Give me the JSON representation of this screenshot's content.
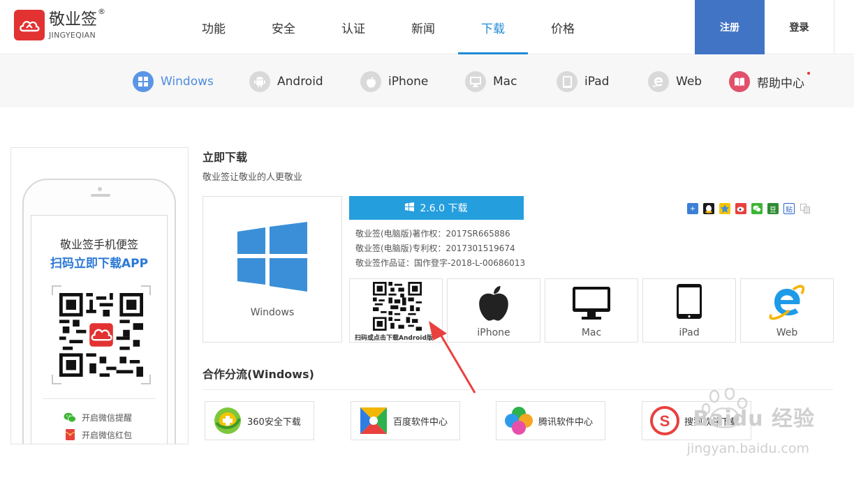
{
  "brand": {
    "name_cn": "敬业签",
    "reg": "®",
    "name_en": "JINGYEQIAN",
    "color": "#e23232"
  },
  "nav": {
    "items": [
      {
        "label": "功能"
      },
      {
        "label": "安全"
      },
      {
        "label": "认证"
      },
      {
        "label": "新闻"
      },
      {
        "label": "下载",
        "active": true
      },
      {
        "label": "价格"
      }
    ],
    "register_label": "注册",
    "login_label": "登录",
    "accent": "#1f8ad6"
  },
  "platforms": [
    {
      "label": "Windows",
      "icon": "windows-icon",
      "active": true
    },
    {
      "label": "Android",
      "icon": "android-icon"
    },
    {
      "label": "iPhone",
      "icon": "apple-icon"
    },
    {
      "label": "Mac",
      "icon": "monitor-icon"
    },
    {
      "label": "iPad",
      "icon": "tablet-icon"
    },
    {
      "label": "Web",
      "icon": "ie-icon"
    },
    {
      "label": "帮助中心",
      "icon": "book-icon",
      "badge": true
    }
  ],
  "phone": {
    "title": "敬业签手机便签",
    "subtitle": "扫码立即下载APP",
    "links": [
      {
        "label": "开启微信提醒",
        "icon": "wechat-icon"
      },
      {
        "label": "开启微信红包",
        "icon": "red-packet-icon"
      }
    ]
  },
  "download": {
    "title": "立即下载",
    "desc": "敬业签让敬业的人更敬业",
    "main_platform": "Windows",
    "button_label": "2.6.0 下载",
    "info": [
      "敬业签(电脑版)著作权：2017SR665886",
      "敬业签(电脑版)专利权：2017301519674",
      "敬业签作品证：国作登字-2018-L-00686013"
    ],
    "qr_label": "扫码或点击下载Android版",
    "cards": [
      {
        "label": "iPhone",
        "icon": "apple-icon"
      },
      {
        "label": "Mac",
        "icon": "monitor-icon"
      },
      {
        "label": "iPad",
        "icon": "tablet-icon"
      },
      {
        "label": "Web",
        "icon": "ie-icon"
      }
    ],
    "share_icons": [
      "share-plus-icon",
      "qq-icon",
      "qzone-icon",
      "weibo-icon",
      "wechat-icon",
      "douban-icon",
      "tieba-icon",
      "copy-icon"
    ]
  },
  "partners": {
    "title": "合作分流(Windows)",
    "items": [
      {
        "label": "360安全下载",
        "icon": "360-icon"
      },
      {
        "label": "百度软件中心",
        "icon": "baidu-soft-icon"
      },
      {
        "label": "腾讯软件中心",
        "icon": "tencent-soft-icon"
      },
      {
        "label": "搜狗软件下载",
        "icon": "sogou-icon"
      }
    ]
  },
  "watermark": {
    "main": "Baidu 经验",
    "sub": "jingyan.baidu.com"
  }
}
